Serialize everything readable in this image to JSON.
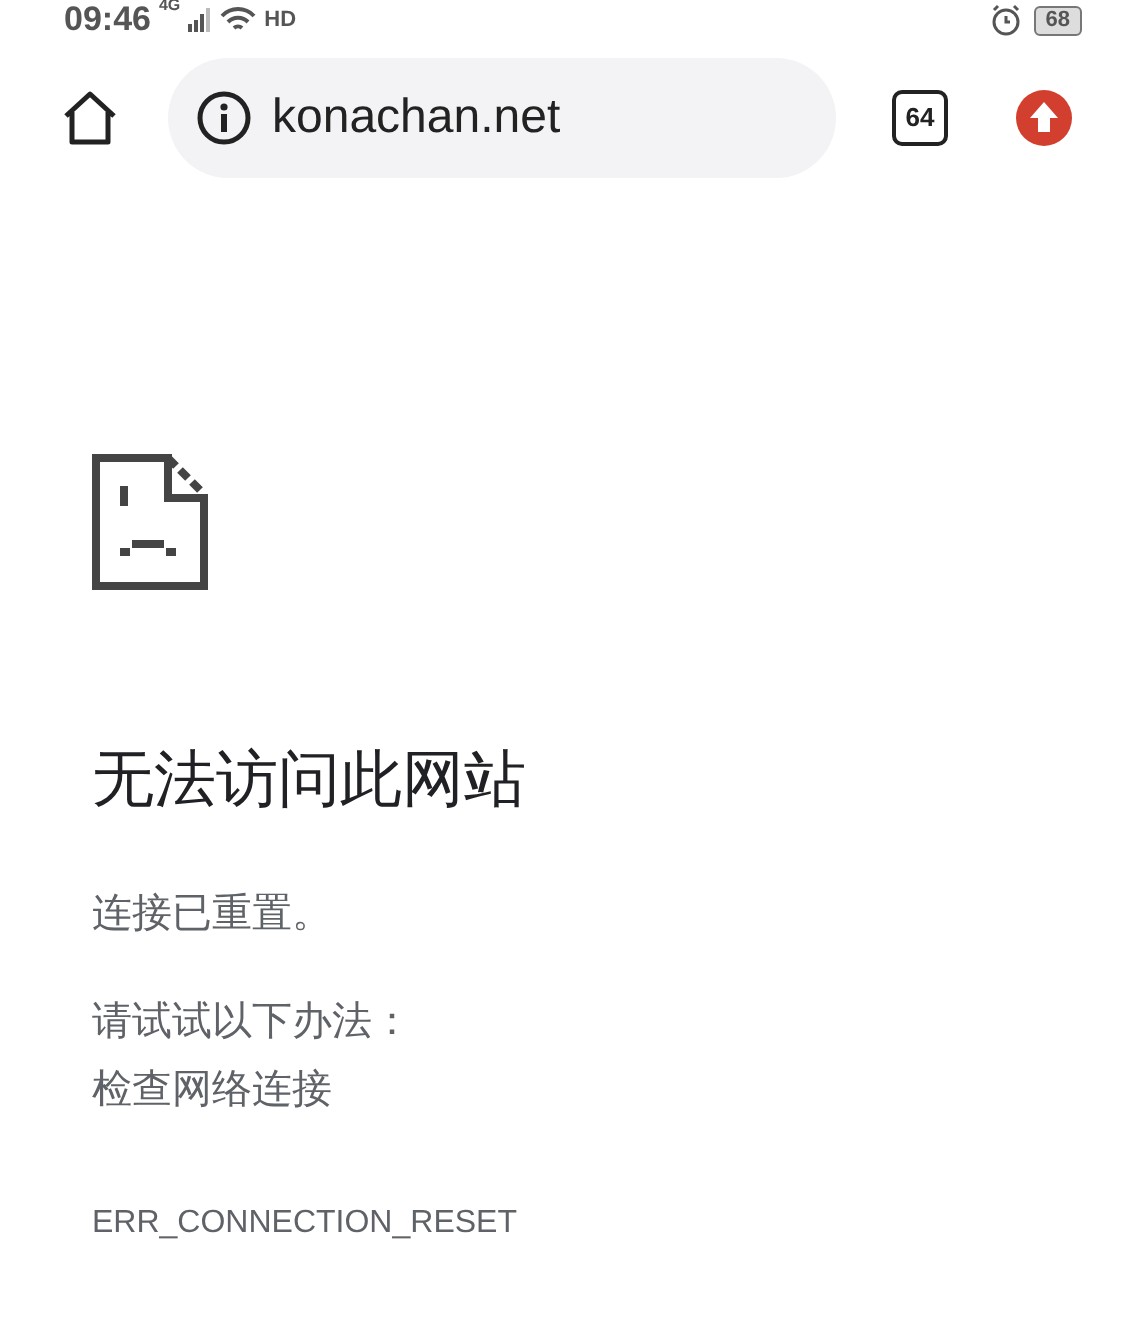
{
  "status_bar": {
    "time": "09:46",
    "network": "4G",
    "call": "HD",
    "battery": "68"
  },
  "toolbar": {
    "url": "konachan.net",
    "tab_count": "64"
  },
  "error": {
    "title": "无法访问此网站",
    "message": "连接已重置。",
    "suggestion_heading": "请试试以下办法：",
    "suggestions": [
      "检查网络连接"
    ],
    "code": "ERR_CONNECTION_RESET"
  }
}
